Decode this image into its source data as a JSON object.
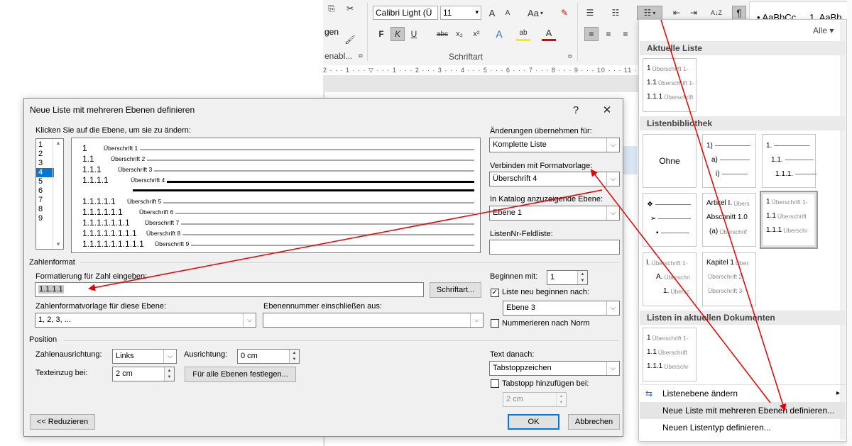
{
  "ribbon": {
    "left_labels": [
      "gen",
      "enabl..."
    ],
    "font_name": "Calibri Light (Ü",
    "font_size": "11",
    "aa_label": "Aa",
    "group_label": "Schriftart",
    "styles_preview": [
      "AaBbCc",
      "1. AaBb"
    ],
    "btn_grow": "A",
    "btn_shrink": "A",
    "btn_bold": "F",
    "btn_italic": "K",
    "btn_underline": "U",
    "btn_strike": "abc",
    "btn_sub": "x₂",
    "btn_sup": "x²",
    "btn_effects": "A",
    "btn_highlight": "ab",
    "btn_color": "A",
    "pilcrow": "¶",
    "sort": "A↓Z"
  },
  "ruler_text": "2 · · · 1 · · · ▽ · · · 1 · · · 2 · · · 3 · · · 4 · · · 5 · · · 6 · · · 7 · · · 8 · · · 9 · · · 10 · · · 11 · · · 12 · · · 13",
  "dialog": {
    "title": "Neue Liste mit mehreren Ebenen definieren",
    "help": "?",
    "close": "✕",
    "level_prompt": "Klicken Sie auf die Ebene, um sie zu ändern:",
    "levels": [
      "1",
      "2",
      "3",
      "4",
      "5",
      "6",
      "7",
      "8",
      "9"
    ],
    "selected_level": "4",
    "preview": [
      {
        "num": "1",
        "text": "Überschrift 1"
      },
      {
        "num": "1.1",
        "text": "Überschrift 2"
      },
      {
        "num": "1.1.1",
        "text": "Überschrift 3"
      },
      {
        "num": "1.1.1.1",
        "text": "Überschrift 4"
      },
      {
        "num": "1.1.1.1.1",
        "text": "Überschrift 5"
      },
      {
        "num": "1.1.1.1.1.1",
        "text": "Überschrift 6"
      },
      {
        "num": "1.1.1.1.1.1.1",
        "text": "Überschrift 7"
      },
      {
        "num": "1.1.1.1.1.1.1.1",
        "text": "Überschrift 8"
      },
      {
        "num": "1.1.1.1.1.1.1.1.1",
        "text": "Überschrift 9"
      }
    ],
    "apply_label": "Änderungen übernehmen für:",
    "apply_value": "Komplette Liste",
    "link_label": "Verbinden mit Formatvorlage:",
    "link_value": "Überschrift 4",
    "gallery_label": "In Katalog anzuzeigende Ebene:",
    "gallery_value": "Ebene 1",
    "listnum_label": "ListenNr-Feldliste:",
    "listnum_value": "",
    "number_format_section": "Zahlenformat",
    "format_label": "Formatierung für Zahl eingeben:",
    "format_value": "1.1.1.1",
    "font_button": "Schriftart...",
    "style_label": "Zahlenformatvorlage für diese Ebene:",
    "style_value": "1, 2, 3, ...",
    "include_label": "Ebenennummer einschließen aus:",
    "include_value": "",
    "start_label": "Beginnen mit:",
    "start_value": "1",
    "restart_label": "Liste neu beginnen nach:",
    "restart_checked": true,
    "restart_value": "Ebene 3",
    "legal_label": "Nummerieren nach Norm",
    "legal_checked": false,
    "position_section": "Position",
    "align_label": "Zahlenausrichtung:",
    "align_value": "Links",
    "aligned_at_label": "Ausrichtung:",
    "aligned_at_value": "0 cm",
    "indent_label": "Texteinzug bei:",
    "indent_value": "2 cm",
    "set_all_button": "Für alle Ebenen festlegen...",
    "follow_label": "Text danach:",
    "follow_value": "Tabstoppzeichen",
    "tabstop_label": "Tabstopp hinzufügen bei:",
    "tabstop_checked": false,
    "tabstop_value": "2 cm",
    "less_button": "<< Reduzieren",
    "ok_button": "OK",
    "cancel_button": "Abbrechen"
  },
  "panel": {
    "filter": "Alle ▾",
    "current_header": "Aktuelle Liste",
    "library_header": "Listenbibliothek",
    "docs_header": "Listen in aktuellen Dokumenten",
    "none_label": "Ohne",
    "current_tile": [
      {
        "n": "1",
        "g": "Überschrift 1-"
      },
      {
        "n": "1.1",
        "g": "Überschrift 1-"
      },
      {
        "n": "1.1.1",
        "g": "Überschrift"
      }
    ],
    "tile_paren": [
      "1)",
      "a)",
      "i)"
    ],
    "tile_decimal": [
      "1.",
      "1.1.",
      "1.1.1."
    ],
    "tile_bullets": [
      "❖",
      "➢",
      "▪"
    ],
    "tile_article": [
      {
        "n": "Artikel I.",
        "g": "Übers"
      },
      {
        "n": "Abschnitt 1.0",
        "g": ""
      },
      {
        "n": "(a)",
        "g": "Überschrif"
      }
    ],
    "tile_heading": [
      {
        "n": "1",
        "g": "Überschrift 1-"
      },
      {
        "n": "1.1",
        "g": "Überschrift"
      },
      {
        "n": "1.1.1",
        "g": "Überschr"
      }
    ],
    "tile_roman": [
      {
        "n": "I.",
        "g": "Überschrift 1-"
      },
      {
        "n": "A.",
        "g": "Überschri"
      },
      {
        "n": "1.",
        "g": "Übersc"
      }
    ],
    "tile_chapter": [
      {
        "n": "Kapitel 1",
        "g": "Über"
      },
      {
        "n": "",
        "g": "Überschrift 2-"
      },
      {
        "n": "",
        "g": "Überschrift 3-"
      }
    ],
    "doc_tile": [
      {
        "n": "1",
        "g": "Überschrift 1-"
      },
      {
        "n": "1.1",
        "g": "Überschrift"
      },
      {
        "n": "1.1.1",
        "g": "Überschr"
      }
    ],
    "menu_change_level": "Listenebene ändern",
    "menu_define_new": "Neue Liste mit mehreren Ebenen definieren...",
    "menu_define_style": "Neuen Listentyp definieren..."
  },
  "colors": {
    "accent": "#0078d7",
    "arrow": "#e00000",
    "selected_level_bg": "#0078d7"
  }
}
